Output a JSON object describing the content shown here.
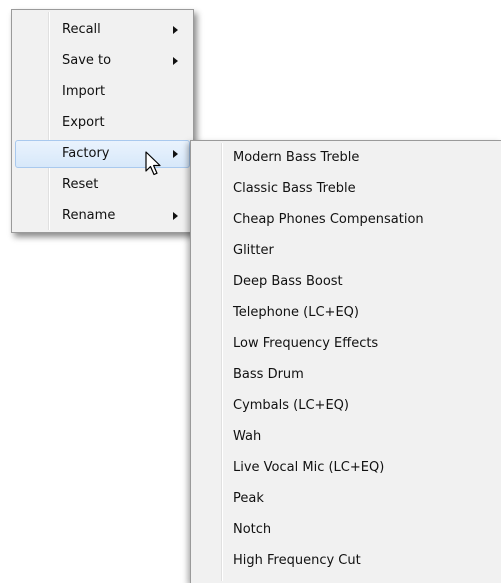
{
  "main_menu": {
    "items": [
      {
        "label": "Recall",
        "has_submenu": true
      },
      {
        "label": "Save to",
        "has_submenu": true
      },
      {
        "label": "Import",
        "has_submenu": false
      },
      {
        "label": "Export",
        "has_submenu": false
      },
      {
        "label": "Factory",
        "has_submenu": true,
        "highlighted": true
      },
      {
        "label": "Reset",
        "has_submenu": false
      },
      {
        "label": "Rename",
        "has_submenu": true
      }
    ]
  },
  "factory_submenu": {
    "items": [
      {
        "label": "Modern Bass Treble"
      },
      {
        "label": "Classic Bass Treble"
      },
      {
        "label": "Cheap Phones Compensation"
      },
      {
        "label": "Glitter"
      },
      {
        "label": "Deep Bass Boost"
      },
      {
        "label": "Telephone (LC+EQ)"
      },
      {
        "label": "Low Frequency Effects"
      },
      {
        "label": "Bass Drum"
      },
      {
        "label": "Cymbals (LC+EQ)"
      },
      {
        "label": "Wah"
      },
      {
        "label": "Live Vocal Mic (LC+EQ)"
      },
      {
        "label": "Peak"
      },
      {
        "label": "Notch"
      },
      {
        "label": "High Frequency Cut"
      }
    ]
  },
  "icons": {
    "submenu_arrow": "chevron-right-icon",
    "cursor": "mouse-pointer-icon"
  },
  "colors": {
    "menu_background": "#f1f1f1",
    "highlight_background": "#dce9fb",
    "highlight_border": "#a9c9ee"
  }
}
